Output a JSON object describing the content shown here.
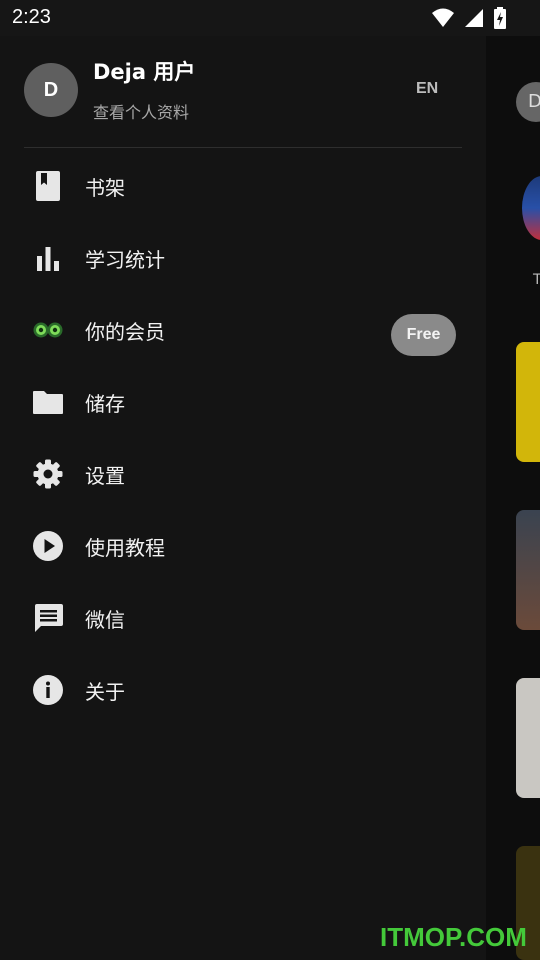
{
  "status_bar": {
    "time": "2:23"
  },
  "profile": {
    "avatar_letter": "D",
    "name": "Deja 用户",
    "view_profile": "查看个人资料",
    "language": "EN"
  },
  "menu": [
    {
      "label": "书架",
      "icon": "bookmark-icon"
    },
    {
      "label": "学习统计",
      "icon": "bar-chart-icon"
    },
    {
      "label": "你的会员",
      "icon": "membership-eyes-icon",
      "badge": "Free"
    },
    {
      "label": "储存",
      "icon": "folder-icon"
    },
    {
      "label": "设置",
      "icon": "gear-icon"
    },
    {
      "label": "使用教程",
      "icon": "play-circle-icon"
    },
    {
      "label": "微信",
      "icon": "chat-icon"
    },
    {
      "label": "关于",
      "icon": "info-icon"
    }
  ],
  "background": {
    "avatar_letter": "D",
    "label": "T"
  },
  "watermark": "ITMOP.COM",
  "colors": {
    "drawer_bg": "#141414",
    "badge_bg": "#8a8a8a",
    "watermark": "#44c93a"
  }
}
